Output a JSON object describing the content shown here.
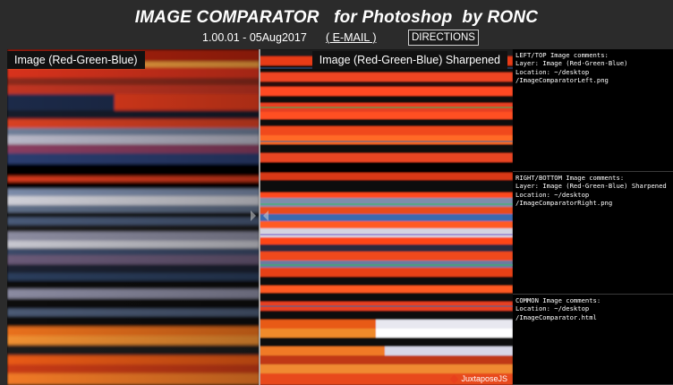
{
  "header": {
    "title": "IMAGE COMPARATOR   for Photoshop  by RONC",
    "version": "1.00.01 - 05Aug2017",
    "email_label": "( E-MAIL )",
    "directions_label": "DIRECTIONS"
  },
  "comparator": {
    "left_label": "Image (Red-Green-Blue)",
    "right_label": "Image (Red-Green-Blue) Sharpened",
    "brand": "JuxtaposeJS"
  },
  "comments": {
    "left": {
      "heading": "LEFT/TOP Image comments:",
      "layer": "Layer: Image (Red-Green-Blue)",
      "location": "Location: ~/desktop",
      "file": "/ImageComparatorLeft.png"
    },
    "right": {
      "heading": "RIGHT/BOTTOM Image comments:",
      "layer": "Layer: Image (Red-Green-Blue) Sharpened",
      "location": "Location: ~/desktop",
      "file": "/ImageComparatorRight.png"
    },
    "common": {
      "heading": "COMMON Image comments:",
      "location": "Location: ~/desktop",
      "file": "/ImageComparator.html"
    }
  },
  "colors": {
    "background": "#2b2b2b",
    "red_streak": "#e8401c",
    "orange_streak": "#f07a2a",
    "blue_streak": "#3b5e9a",
    "divider": "#bdbdbd"
  }
}
